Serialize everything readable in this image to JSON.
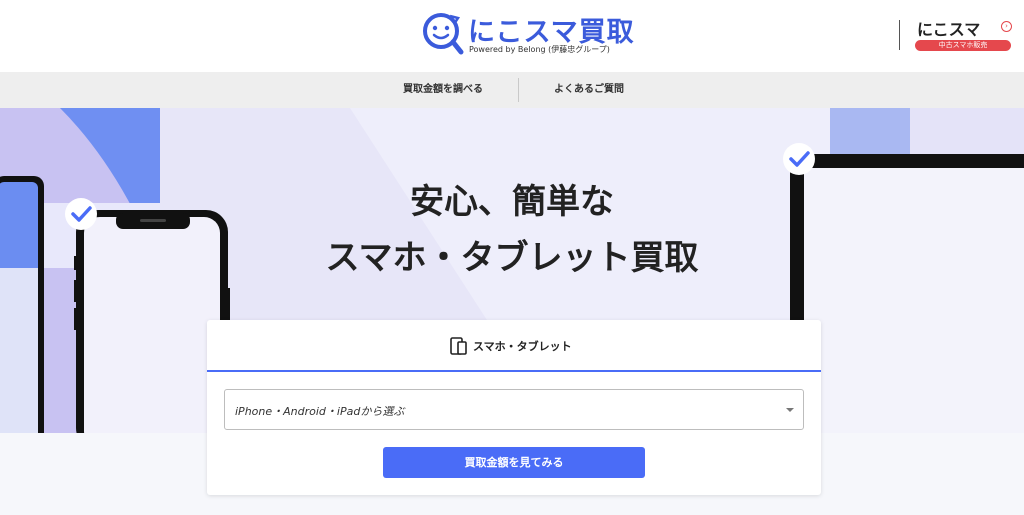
{
  "header": {
    "logo_title": "にこスマ買取",
    "logo_subtitle": "Powered by Belong (伊藤忠グループ)",
    "partner_title": "にこスマ",
    "partner_badge": "中古スマホ販売",
    "partner_arrow_icon": "chevron-right-circle-icon"
  },
  "nav": {
    "items": [
      {
        "label": "買取金額を調べる"
      },
      {
        "label": "よくあるご質問"
      }
    ]
  },
  "hero": {
    "headline_line1": "安心、簡単な",
    "headline_line2": "スマホ・タブレット買取"
  },
  "form": {
    "tab_label": "スマホ・タブレット",
    "tab_icon": "phone-tablet-icon",
    "select_value": "iPhone・Android・iPadから選ぶ",
    "cta_label": "買取金額を見てみる"
  },
  "colors": {
    "accent": "#4a6cf7",
    "logo_blue": "#3b5bdb",
    "partner_red": "#e5484d",
    "hero_bg": "#e7e6f8"
  }
}
